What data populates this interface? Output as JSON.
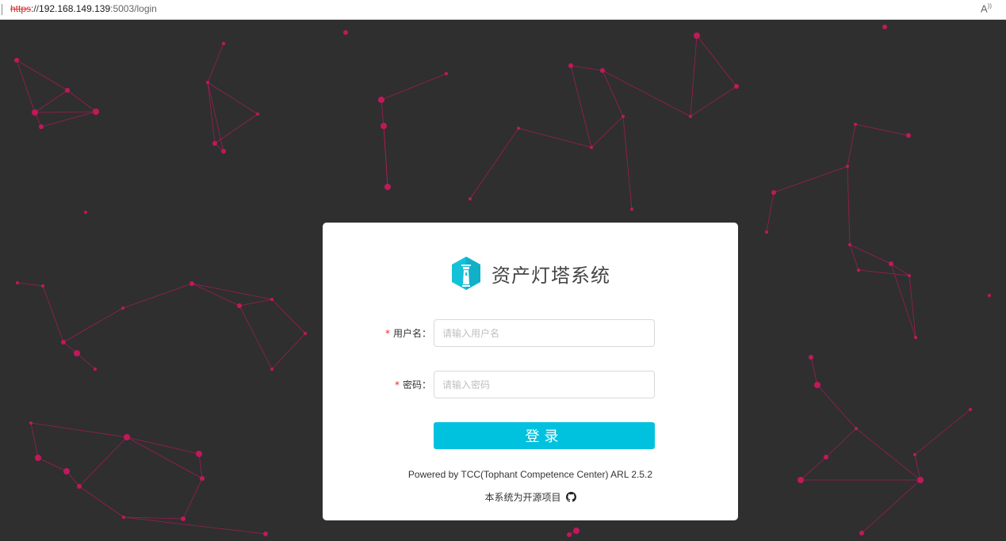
{
  "browser": {
    "url_scheme": "https",
    "url_sep": "://",
    "url_host": "192.168.149.139",
    "url_path": ":5003/login",
    "read_aloud_icon": "read-aloud-icon"
  },
  "colors": {
    "background": "#2f2f2f",
    "network_nodes": "#c2185b",
    "accent": "#00c1de",
    "required": "#f5222d"
  },
  "login": {
    "title": "资产灯塔系统",
    "logo_icon": "lighthouse-icon",
    "username_label": "用户名：",
    "username_placeholder": "请输入用户名",
    "password_label": "密码：",
    "password_placeholder": "请输入密码",
    "required_mark": "*",
    "submit_label": "登录",
    "powered_by": "Powered by TCC(Tophant Competence Center) ARL 2.5.2",
    "open_source_text": "本系统为开源项目",
    "github_icon": "github-icon"
  }
}
